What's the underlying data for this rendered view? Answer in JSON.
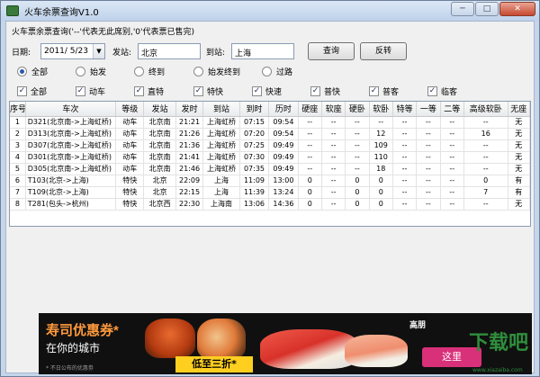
{
  "window": {
    "title": "火车余票查询V1.0",
    "minimize": "─",
    "maximize": "□",
    "close": "✕"
  },
  "hint": "火车票余票查询('--'代表无此席别,'0'代表票已售完)",
  "query": {
    "date_label": "日期:",
    "date_value": "2011/ 5/23",
    "from_label": "发站:",
    "from_value": "北京",
    "to_label": "到站:",
    "to_value": "上海",
    "search_button": "查询",
    "reverse_button": "反转"
  },
  "station_filter": [
    {
      "label": "全部",
      "checked": true
    },
    {
      "label": "始发",
      "checked": false
    },
    {
      "label": "终到",
      "checked": false
    },
    {
      "label": "始发终到",
      "checked": false
    },
    {
      "label": "过路",
      "checked": false
    }
  ],
  "train_types": [
    {
      "label": "全部",
      "checked": true
    },
    {
      "label": "动车",
      "checked": true
    },
    {
      "label": "直特",
      "checked": true
    },
    {
      "label": "特快",
      "checked": true
    },
    {
      "label": "快速",
      "checked": true
    },
    {
      "label": "普快",
      "checked": true
    },
    {
      "label": "普客",
      "checked": true
    },
    {
      "label": "临客",
      "checked": true
    }
  ],
  "table": {
    "columns": [
      "序号",
      "车次",
      "等级",
      "发站",
      "发时",
      "到站",
      "到时",
      "历时",
      "硬座",
      "软座",
      "硬卧",
      "软卧",
      "特等",
      "一等",
      "二等",
      "高级软卧",
      "无座"
    ],
    "rows": [
      [
        "1",
        "D321(北京南->上海虹桥)",
        "动车",
        "北京南",
        "21:21",
        "上海虹桥",
        "07:15",
        "09:54",
        "--",
        "--",
        "--",
        "--",
        "--",
        "--",
        "--",
        "--",
        "无"
      ],
      [
        "2",
        "D313(北京南->上海虹桥)",
        "动车",
        "北京南",
        "21:26",
        "上海虹桥",
        "07:20",
        "09:54",
        "--",
        "--",
        "--",
        "12",
        "--",
        "--",
        "--",
        "16",
        "无"
      ],
      [
        "3",
        "D307(北京南->上海虹桥)",
        "动车",
        "北京南",
        "21:36",
        "上海虹桥",
        "07:25",
        "09:49",
        "--",
        "--",
        "--",
        "109",
        "--",
        "--",
        "--",
        "--",
        "无"
      ],
      [
        "4",
        "D301(北京南->上海虹桥)",
        "动车",
        "北京南",
        "21:41",
        "上海虹桥",
        "07:30",
        "09:49",
        "--",
        "--",
        "--",
        "110",
        "--",
        "--",
        "--",
        "--",
        "无"
      ],
      [
        "5",
        "D305(北京南->上海虹桥)",
        "动车",
        "北京南",
        "21:46",
        "上海虹桥",
        "07:35",
        "09:49",
        "--",
        "--",
        "--",
        "18",
        "--",
        "--",
        "--",
        "--",
        "无"
      ],
      [
        "6",
        "T103(北京->上海)",
        "特快",
        "北京",
        "22:09",
        "上海",
        "11:09",
        "13:00",
        "0",
        "--",
        "0",
        "0",
        "--",
        "--",
        "--",
        "0",
        "有"
      ],
      [
        "7",
        "T109(北京->上海)",
        "特快",
        "北京",
        "22:15",
        "上海",
        "11:39",
        "13:24",
        "0",
        "--",
        "0",
        "0",
        "--",
        "--",
        "--",
        "7",
        "有"
      ],
      [
        "8",
        "T281(包头->杭州)",
        "特快",
        "北京西",
        "22:30",
        "上海南",
        "13:06",
        "14:36",
        "0",
        "--",
        "0",
        "0",
        "--",
        "--",
        "--",
        "--",
        "无"
      ]
    ]
  },
  "ad": {
    "title": "寿司优惠券*",
    "subtitle": "在你的城市",
    "fine_print": "* 不日公布的优惠劵",
    "offer": "低至三折*",
    "brand": "高朋",
    "button": "这里"
  },
  "watermark": {
    "main": "下载吧",
    "url": "www.xiazaiba.com"
  },
  "colors": {
    "title_bar": "#c5d6ea",
    "ad_accent": "#ff9a3c",
    "ad_button": "#d9307a",
    "watermark": "#2f8e3c"
  }
}
